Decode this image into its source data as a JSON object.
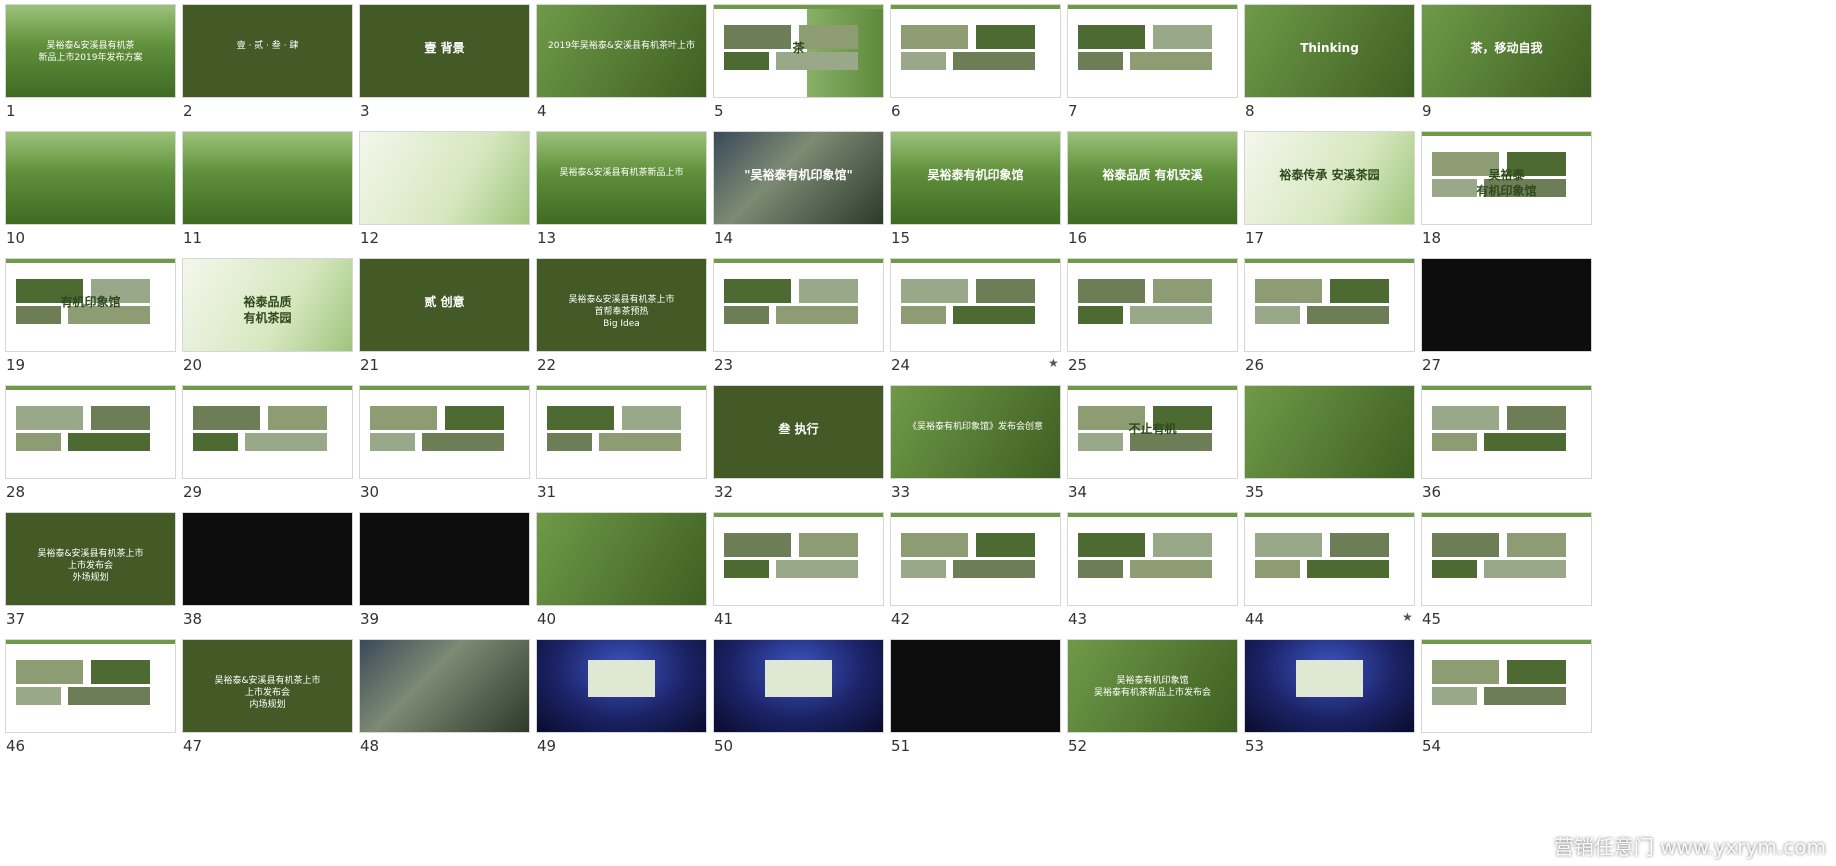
{
  "slides": [
    {
      "number": "1",
      "theme": "field",
      "caption": "吴裕泰&安溪县有机茶\n新品上市2019年发布方案"
    },
    {
      "number": "2",
      "theme": "dark",
      "caption": "壹 · 贰 · 叁 · 肆"
    },
    {
      "number": "3",
      "theme": "dark",
      "caption": "壹  背景"
    },
    {
      "number": "4",
      "theme": "green",
      "caption": "2019年吴裕泰&安溪县有机茶叶上市"
    },
    {
      "number": "5",
      "theme": "mixed",
      "caption": "茶"
    },
    {
      "number": "6",
      "theme": "white",
      "caption": ""
    },
    {
      "number": "7",
      "theme": "white",
      "caption": ""
    },
    {
      "number": "8",
      "theme": "green",
      "caption": "Thinking"
    },
    {
      "number": "9",
      "theme": "green",
      "caption": "茶，移动自我"
    },
    {
      "number": "10",
      "theme": "field",
      "caption": ""
    },
    {
      "number": "11",
      "theme": "field",
      "caption": ""
    },
    {
      "number": "12",
      "theme": "light",
      "caption": ""
    },
    {
      "number": "13",
      "theme": "field",
      "caption": "吴裕泰&安溪县有机茶新品上市"
    },
    {
      "number": "14",
      "theme": "photo",
      "caption": "\"吴裕泰有机印象馆\""
    },
    {
      "number": "15",
      "theme": "field",
      "caption": "吴裕泰有机印象馆"
    },
    {
      "number": "16",
      "theme": "field",
      "caption": "裕泰品质 有机安溪"
    },
    {
      "number": "17",
      "theme": "light",
      "caption": "裕泰传承 安溪茶园"
    },
    {
      "number": "18",
      "theme": "white",
      "caption": "吴裕泰\n有机印象馆"
    },
    {
      "number": "19",
      "theme": "white",
      "caption": "有机印象馆"
    },
    {
      "number": "20",
      "theme": "light",
      "caption": "裕泰品质\n有机茶园"
    },
    {
      "number": "21",
      "theme": "dark",
      "caption": "贰  创意"
    },
    {
      "number": "22",
      "theme": "dark",
      "caption": "吴裕泰&安溪县有机茶上市\n首帮奉茶预热\nBig Idea"
    },
    {
      "number": "23",
      "theme": "white",
      "caption": ""
    },
    {
      "number": "24",
      "theme": "white",
      "caption": "",
      "starred": true
    },
    {
      "number": "25",
      "theme": "white",
      "caption": ""
    },
    {
      "number": "26",
      "theme": "white",
      "caption": ""
    },
    {
      "number": "27",
      "theme": "black",
      "caption": ""
    },
    {
      "number": "28",
      "theme": "white",
      "caption": ""
    },
    {
      "number": "29",
      "theme": "white",
      "caption": ""
    },
    {
      "number": "30",
      "theme": "white",
      "caption": ""
    },
    {
      "number": "31",
      "theme": "white",
      "caption": ""
    },
    {
      "number": "32",
      "theme": "dark",
      "caption": "叁  执行"
    },
    {
      "number": "33",
      "theme": "green",
      "caption": "《吴裕泰有机印象馆》发布会创意"
    },
    {
      "number": "34",
      "theme": "white",
      "caption": "不止有机"
    },
    {
      "number": "35",
      "theme": "green",
      "caption": ""
    },
    {
      "number": "36",
      "theme": "white",
      "caption": ""
    },
    {
      "number": "37",
      "theme": "dark",
      "caption": "吴裕泰&安溪县有机茶上市\n上市发布会\n外场规划"
    },
    {
      "number": "38",
      "theme": "black",
      "caption": ""
    },
    {
      "number": "39",
      "theme": "black",
      "caption": ""
    },
    {
      "number": "40",
      "theme": "green",
      "caption": ""
    },
    {
      "number": "41",
      "theme": "white",
      "caption": ""
    },
    {
      "number": "42",
      "theme": "white",
      "caption": ""
    },
    {
      "number": "43",
      "theme": "white",
      "caption": ""
    },
    {
      "number": "44",
      "theme": "white",
      "caption": "",
      "starred": true
    },
    {
      "number": "45",
      "theme": "white",
      "caption": ""
    },
    {
      "number": "46",
      "theme": "white",
      "caption": ""
    },
    {
      "number": "47",
      "theme": "dark",
      "caption": "吴裕泰&安溪县有机茶上市\n上市发布会\n内场规划"
    },
    {
      "number": "48",
      "theme": "photo",
      "caption": ""
    },
    {
      "number": "49",
      "theme": "stage",
      "caption": ""
    },
    {
      "number": "50",
      "theme": "stage",
      "caption": ""
    },
    {
      "number": "51",
      "theme": "black",
      "caption": ""
    },
    {
      "number": "52",
      "theme": "green",
      "caption": "吴裕泰有机印象馆\n吴裕泰有机茶新品上市发布会"
    },
    {
      "number": "53",
      "theme": "stage",
      "caption": ""
    },
    {
      "number": "54",
      "theme": "white",
      "caption": ""
    }
  ],
  "watermark": "营销任意门 www.yxrym.com",
  "colors": {
    "accent": "#5f8a3a",
    "dark": "#435a27"
  }
}
